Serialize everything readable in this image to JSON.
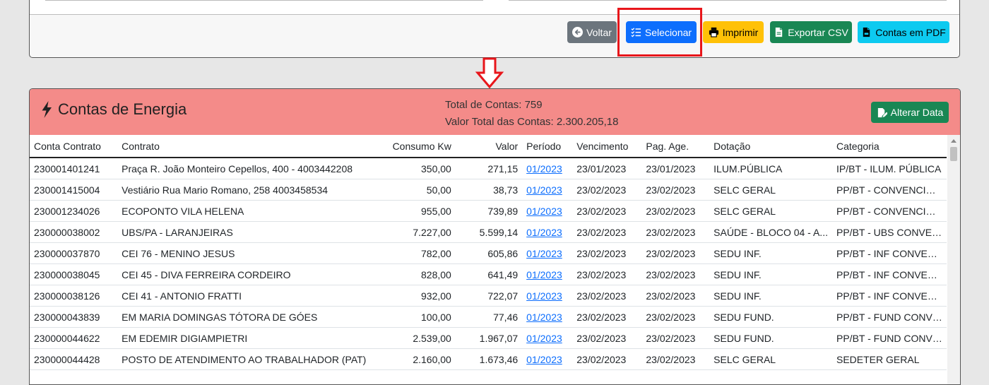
{
  "toolbar": {
    "voltar_label": "Voltar",
    "selecionar_label": "Selecionar",
    "imprimir_label": "Imprimir",
    "exportar_csv_label": "Exportar CSV",
    "contas_pdf_label": "Contas em PDF"
  },
  "card": {
    "title": "Contas de Energia",
    "total_contas": "Total de Contas: 759",
    "valor_total": "Valor Total das Contas: 2.300.205,18",
    "alterar_data_label": "Alterar Data"
  },
  "table": {
    "headers": [
      "Conta Contrato",
      "Contrato",
      "Consumo Kw",
      "Valor",
      "Período",
      "Vencimento",
      "Pag. Age.",
      "Dotação",
      "Categoria"
    ],
    "rows": [
      [
        "230001401241",
        "Praça R. João Monteiro Cepellos, 400 - 4003442208",
        "350,00",
        "271,15",
        "01/2023",
        "23/01/2023",
        "23/01/2023",
        "ILUM.PÚBLICA",
        "IP/BT - ILUM. PÚBLICA"
      ],
      [
        "230001415004",
        "Vestiário Rua Mario Romano, 258 4003458534",
        "50,00",
        "38,73",
        "01/2023",
        "23/02/2023",
        "23/02/2023",
        "SELC GERAL",
        "PP/BT - CONVENCIONAL"
      ],
      [
        "230001234026",
        "ECOPONTO VILA HELENA",
        "955,00",
        "739,89",
        "01/2023",
        "23/02/2023",
        "23/02/2023",
        "SELC GERAL",
        "PP/BT - CONVENCIONAL"
      ],
      [
        "230000038002",
        "UBS/PA - LARANJEIRAS",
        "7.227,00",
        "5.599,14",
        "01/2023",
        "23/02/2023",
        "23/02/2023",
        "SAÚDE - BLOCO 04 - A...",
        "PP/BT - UBS CONVENCI..."
      ],
      [
        "230000037870",
        "CEI 76 - MENINO JESUS",
        "782,00",
        "605,86",
        "01/2023",
        "23/02/2023",
        "23/02/2023",
        "SEDU INF.",
        "PP/BT - INF CONVENCI..."
      ],
      [
        "230000038045",
        "CEI 45 - DIVA FERREIRA CORDEIRO",
        "828,00",
        "641,49",
        "01/2023",
        "23/02/2023",
        "23/02/2023",
        "SEDU INF.",
        "PP/BT - INF CONVENCI..."
      ],
      [
        "230000038126",
        "CEI 41 - ANTONIO FRATTI",
        "932,00",
        "722,07",
        "01/2023",
        "23/02/2023",
        "23/02/2023",
        "SEDU INF.",
        "PP/BT - INF CONVENCI..."
      ],
      [
        "230000043839",
        "EM MARIA DOMINGAS TÓTORA DE GÓES",
        "100,00",
        "77,46",
        "01/2023",
        "23/02/2023",
        "23/02/2023",
        "SEDU FUND.",
        "PP/BT - FUND CONVEN..."
      ],
      [
        "230000044622",
        "EM EDEMIR DIGIAMPIETRI",
        "2.539,00",
        "1.967,07",
        "01/2023",
        "23/02/2023",
        "23/02/2023",
        "SEDU FUND.",
        "PP/BT - FUND CONVEN..."
      ],
      [
        "230000044428",
        "POSTO DE ATENDIMENTO AO TRABALHADOR (PAT)",
        "2.160,00",
        "1.673,46",
        "01/2023",
        "23/02/2023",
        "23/02/2023",
        "SELC GERAL",
        "SEDETER GERAL"
      ]
    ]
  },
  "colors": {
    "header_bg": "#f48b89",
    "primary": "#0d6efd",
    "success": "#198754",
    "warning": "#ffc107",
    "info": "#0dcaf0",
    "secondary": "#6c757d",
    "annotation_red": "#e8161b"
  },
  "icons": {
    "voltar": "arrow-left-circle-icon",
    "selecionar": "list-check-icon",
    "imprimir": "printer-icon",
    "exportar_csv": "file-csv-icon",
    "contas_pdf": "file-pdf-icon",
    "title": "lightning-bolt-icon",
    "alterar_data": "file-edit-icon"
  }
}
